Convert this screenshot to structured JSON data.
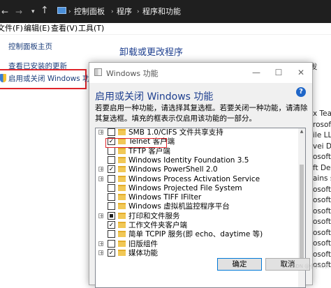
{
  "address_bar": {
    "breadcrumbs": [
      "控制面板",
      "程序",
      "程序和功能"
    ]
  },
  "menu": {
    "file": "文件(F)",
    "edit": "编辑(E)",
    "view": "查看(V)",
    "tools": "工具(T)"
  },
  "sidebar": {
    "home": "控制面板主页",
    "updates": "查看已安装的更新",
    "features": "启用或关闭 Windows 功能"
  },
  "main": {
    "title": "卸载或更改程序"
  },
  "background_right": {
    "header": "发",
    "rows": [
      "x Tea",
      "rosoft",
      "ile LLC",
      "vei De",
      "osoft",
      "ft Dev",
      "ains s.",
      "osoft C",
      "osoft C",
      "osoft C",
      "osoft C",
      "osoft C",
      "osoft C",
      "osoft C",
      "osoft C"
    ]
  },
  "dialog": {
    "title": "Windows 功能",
    "heading": "启用或关闭 Windows 功能",
    "help_label": "?",
    "description": "若要启用一种功能，请选择其复选框。若要关闭一种功能，请清除其复选框。填充的框表示仅启用该功能的一部分。",
    "features": [
      {
        "label": "SMB 1.0/CIFS 文件共享支持",
        "expandable": true,
        "state": "unchecked"
      },
      {
        "label": "Telnet 客户端",
        "expandable": false,
        "state": "checked"
      },
      {
        "label": "TFTP 客户端",
        "expandable": false,
        "state": "unchecked"
      },
      {
        "label": "Windows Identity Foundation 3.5",
        "expandable": false,
        "state": "unchecked"
      },
      {
        "label": "Windows PowerShell 2.0",
        "expandable": true,
        "state": "checked"
      },
      {
        "label": "Windows Process Activation Service",
        "expandable": true,
        "state": "unchecked"
      },
      {
        "label": "Windows Projected File System",
        "expandable": false,
        "state": "unchecked"
      },
      {
        "label": "Windows TIFF IFilter",
        "expandable": false,
        "state": "unchecked"
      },
      {
        "label": "Windows 虚拟机监控程序平台",
        "expandable": false,
        "state": "unchecked"
      },
      {
        "label": "打印和文件服务",
        "expandable": true,
        "state": "partial"
      },
      {
        "label": "工作文件夹客户端",
        "expandable": false,
        "state": "checked"
      },
      {
        "label": "简单 TCPIP 服务(即 echo、daytime 等)",
        "expandable": false,
        "state": "unchecked"
      },
      {
        "label": "旧版组件",
        "expandable": true,
        "state": "unchecked"
      },
      {
        "label": "媒体功能",
        "expandable": true,
        "state": "checked"
      }
    ],
    "ok_label": "确定",
    "cancel_label": "取消"
  },
  "watermark": "CSDN @小小码农"
}
